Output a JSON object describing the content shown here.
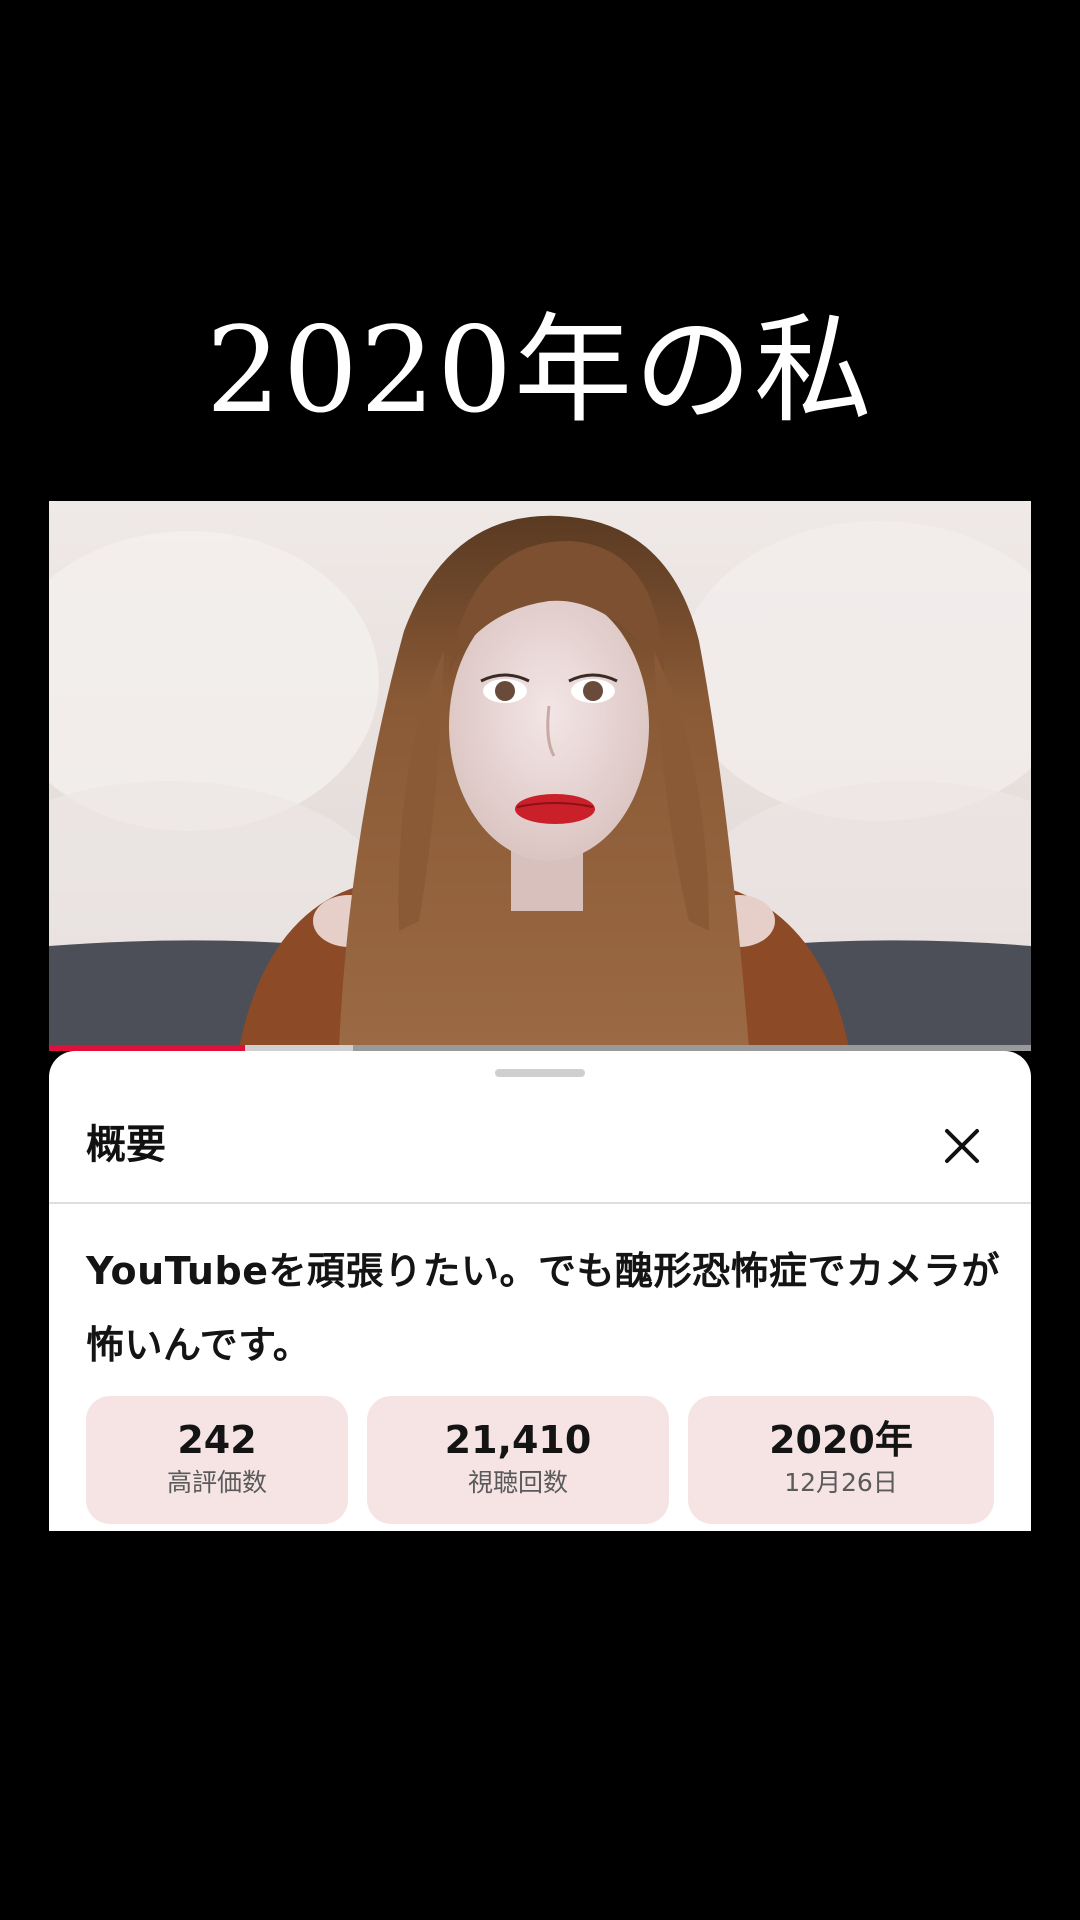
{
  "overlay": {
    "title": "2020年の私"
  },
  "player": {
    "progress_played": 0.2,
    "progress_buffered": 0.31
  },
  "sheet": {
    "title": "概要",
    "close_icon": "close-icon",
    "description": "YouTubeを頑張りたい。でも醜形恐怖症でカメラが怖いんです。",
    "stats": [
      {
        "value": "242",
        "label": "高評価数"
      },
      {
        "value": "21,410",
        "label": "視聴回数"
      },
      {
        "value": "2020年",
        "label": "12月26日"
      }
    ]
  },
  "colors": {
    "background": "#000000",
    "progress_accent": "#e0103a",
    "stat_pill": "#f6e4e5"
  }
}
